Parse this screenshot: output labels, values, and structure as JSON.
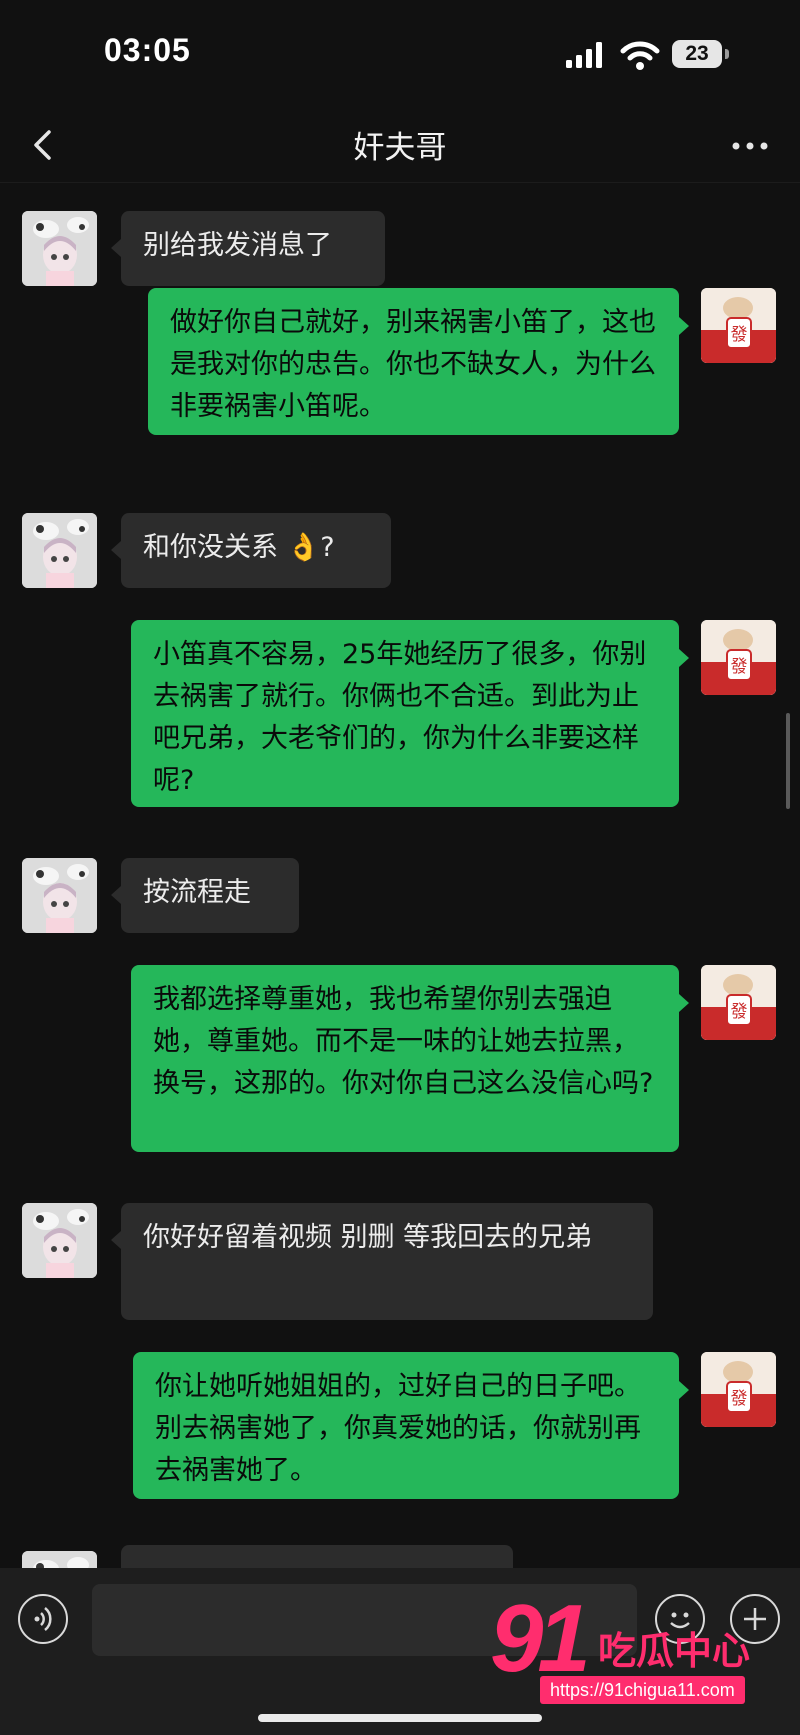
{
  "status_bar": {
    "time": "03:05",
    "battery": "23"
  },
  "header": {
    "title": "奸夫哥"
  },
  "messages": [
    {
      "side": "left",
      "text": "别给我发消息了"
    },
    {
      "side": "right",
      "text": "做好你自己就好，别来祸害小笛了，这也是我对你的忠告。你也不缺女人，为什么非要祸害小笛呢。"
    },
    {
      "side": "left",
      "text": "和你没关系 👌?"
    },
    {
      "side": "right",
      "text": "小笛真不容易，25年她经历了很多，你别去祸害了就行。你俩也不合适。到此为止吧兄弟，大老爷们的，你为什么非要这样呢?"
    },
    {
      "side": "left",
      "text": "按流程走"
    },
    {
      "side": "right",
      "text": "我都选择尊重她，我也希望你别去强迫她，尊重她。而不是一味的让她去拉黑，换号，这那的。你对你自己这么没信心吗?"
    },
    {
      "side": "left",
      "text": "你好好留着视频 别删 等我回去的兄弟"
    },
    {
      "side": "right",
      "text": "你让她听她姐姐的，过好自己的日子吧。别去祸害她了，你真爱她的话，你就别再去祸害她了。"
    }
  ],
  "avatar_right_glyph": "發",
  "watermark": {
    "number": "91",
    "name": "吃瓜中心",
    "url": "https://91chigua11.com"
  },
  "colors": {
    "outgoing_bubble": "#25b75a",
    "incoming_bubble": "#2c2c2c",
    "background": "#111111",
    "watermark": "#ff2d6e"
  },
  "icons": [
    "back-arrow-icon",
    "more-dots-icon",
    "signal-icon",
    "wifi-icon",
    "voice-icon",
    "emoji-icon",
    "plus-icon"
  ]
}
